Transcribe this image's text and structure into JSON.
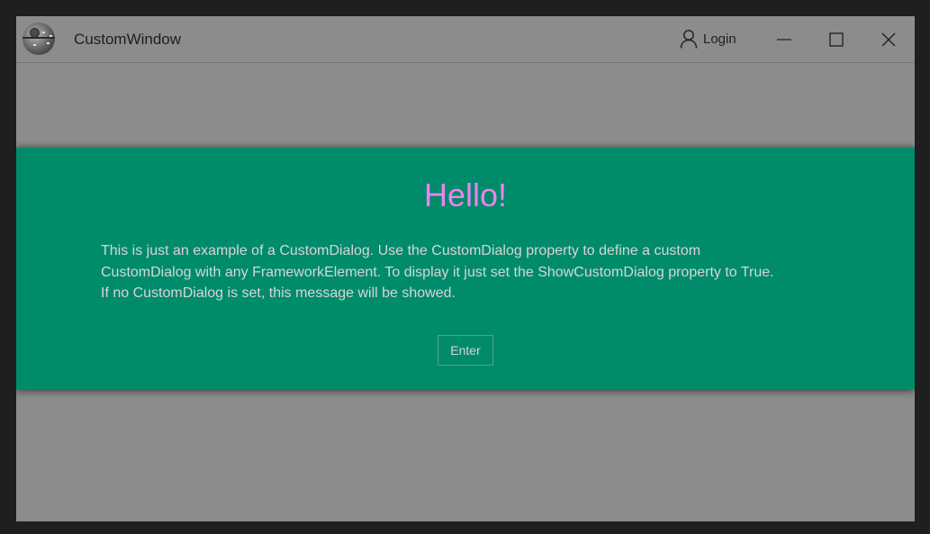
{
  "window": {
    "title": "CustomWindow",
    "app_icon": "death-star-icon"
  },
  "titlebar": {
    "login_label": "Login",
    "login_icon": "user-icon",
    "minimize_icon": "minimize-icon",
    "maximize_icon": "maximize-icon",
    "close_icon": "close-icon"
  },
  "dialog": {
    "title": "Hello!",
    "message_lines": [
      "This is just an example of a CustomDialog. Use the CustomDialog property to define a custom",
      "CustomDialog with any FrameworkElement. To display it just set the ShowCustomDialog property to True.",
      "If no CustomDialog is set, this message will be showed."
    ],
    "button_label": "Enter",
    "colors": {
      "background": "#008b6b",
      "title": "#ee82ee",
      "text": "#d6d6d6"
    }
  },
  "colors": {
    "window_background": "#8c8c8c",
    "outer_background": "#1f1f1f"
  }
}
